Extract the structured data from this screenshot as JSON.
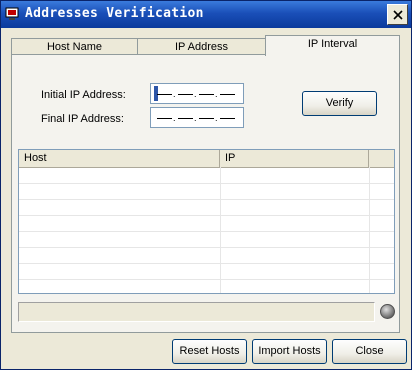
{
  "window": {
    "title": "Addresses Verification"
  },
  "tabs": [
    {
      "label": "Host Name",
      "active": false
    },
    {
      "label": "IP Address",
      "active": false
    },
    {
      "label": "IP Interval",
      "active": true
    }
  ],
  "form": {
    "initial_label": "Initial IP Address:",
    "final_label": "Final IP Address:",
    "verify_label": "Verify"
  },
  "list": {
    "columns": [
      "Host",
      "IP"
    ],
    "rows": []
  },
  "buttons": {
    "reset_label": "Reset Hosts",
    "import_label": "Import Hosts",
    "close_label": "Close"
  },
  "icons": {
    "app": "network-app-icon",
    "close": "close-icon",
    "status": "status-led-icon"
  },
  "colors": {
    "titlebar": "#0b3a9c",
    "face": "#ece9d8"
  }
}
